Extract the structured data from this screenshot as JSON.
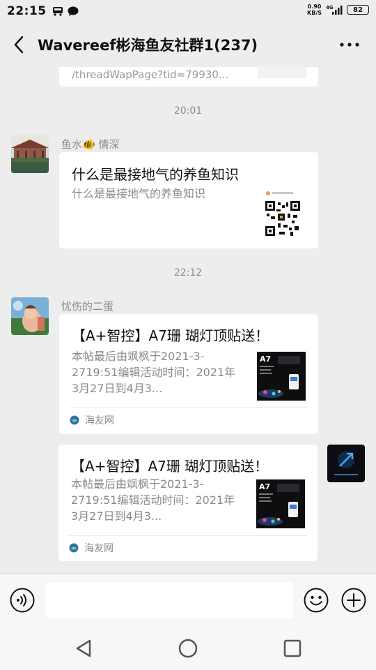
{
  "status_bar": {
    "time": "22:15",
    "net_speed_value": "0.90",
    "net_speed_unit": "KB/S",
    "network": "4G",
    "battery": "82"
  },
  "header": {
    "title": "Wavereef彬海鱼友社群1(237)"
  },
  "messages": {
    "partial_link_text": "/threadWapPage?tid=79930...",
    "time_1": "20:01",
    "msg1": {
      "sender": "鱼水🐠 情深",
      "title": "什么是最接地气的养鱼知识",
      "desc": "什么是最接地气的养鱼知识"
    },
    "time_2": "22:12",
    "msg2": {
      "sender": "忧伤的二蛋",
      "title": "【A+智控】A7珊 瑚灯顶贴送！",
      "desc": "本帖最后由飒枫于2021-3-2719:51编辑活动时间：2021年3月27日到4月3...",
      "thumb_label": "A7",
      "source": "海友网"
    },
    "msg3": {
      "title": "【A+智控】A7珊 瑚灯顶贴送！",
      "desc": "本帖最后由飒枫于2021-3-2719:51编辑活动时间：2021年3月27日到4月3...",
      "thumb_label": "A7",
      "source": "海友网"
    }
  },
  "icons": {
    "back": "chevron-left-icon",
    "more": "more-dots-icon",
    "voice": "voice-icon",
    "emoji": "emoji-icon",
    "plus": "plus-icon",
    "nav_back": "triangle-back-icon",
    "nav_home": "circle-home-icon",
    "nav_recent": "square-recent-icon"
  },
  "colors": {
    "background": "#ededed",
    "card": "#ffffff",
    "secondary_text": "#8a8a8a"
  }
}
